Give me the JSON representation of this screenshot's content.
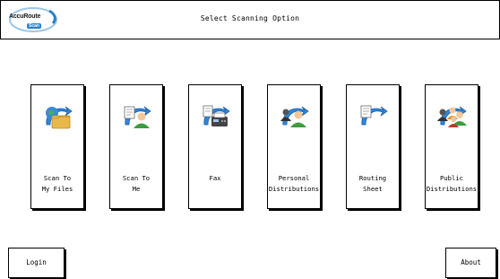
{
  "header": {
    "title": "Select Scanning Option",
    "logo_text": "AccuRoute",
    "logo_sub": "Scan"
  },
  "tiles": [
    {
      "label": "Scan To\nMy Files",
      "icon": "folder-globe-icon"
    },
    {
      "label": "Scan To\nMe",
      "icon": "user-document-icon"
    },
    {
      "label": "Fax",
      "icon": "fax-machine-icon"
    },
    {
      "label": "Personal\nDistributions",
      "icon": "personal-distribution-icon"
    },
    {
      "label": "Routing\nSheet",
      "icon": "routing-sheet-icon"
    },
    {
      "label": "Public\nDistributions",
      "icon": "public-distribution-icon"
    }
  ],
  "footer": {
    "login_label": "Login",
    "about_label": "About"
  },
  "colors": {
    "arrow_blue": "#2f86d6",
    "arrow_dark": "#1d5fa8",
    "folder": "#e8b84a",
    "person_green": "#3d9c3d",
    "person_orange": "#e08a2e"
  }
}
